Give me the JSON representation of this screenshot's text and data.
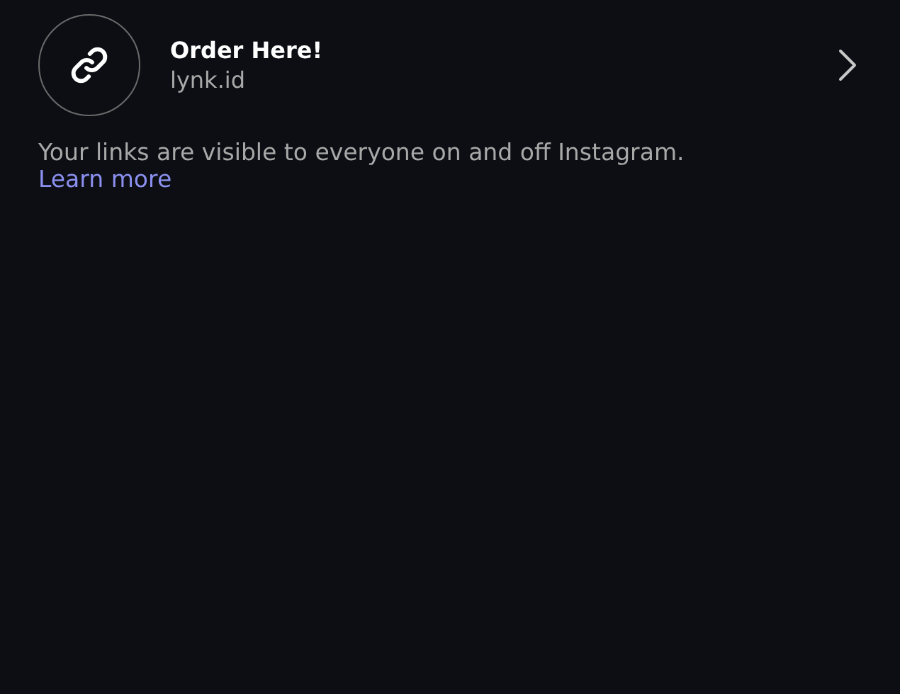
{
  "links": [
    {
      "title": "Order Here!",
      "url": "lynk.id"
    }
  ],
  "notice": {
    "text": "Your links are visible to everyone on and off Instagram.",
    "link": "Learn more"
  }
}
